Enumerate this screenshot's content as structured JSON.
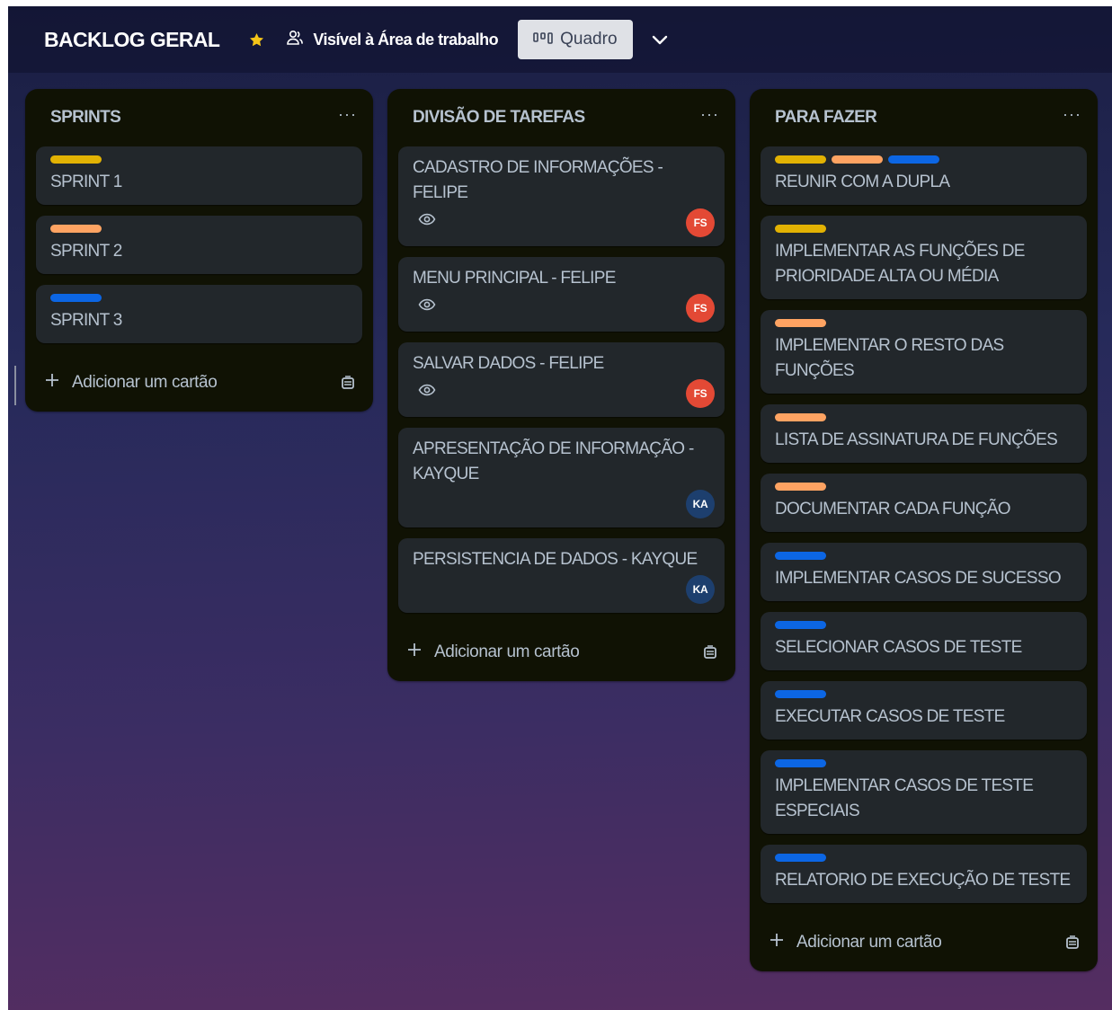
{
  "header": {
    "title": "BACKLOG GERAL",
    "visibility": "Visível à Área de trabalho",
    "view": "Quadro"
  },
  "colors": {
    "yellow": "#e2b203",
    "orange": "#fea362",
    "blue": "#0c66e4",
    "avatar_fs": "#e34935",
    "avatar_ka": "#1d3f6e"
  },
  "lists": [
    {
      "title": "SPRINTS",
      "menu": "···",
      "add_label": "Adicionar um cartão",
      "cards": [
        {
          "labels": [
            "yellow"
          ],
          "title": "SPRINT 1"
        },
        {
          "labels": [
            "orange"
          ],
          "title": "SPRINT 2"
        },
        {
          "labels": [
            "blue"
          ],
          "title": "SPRINT 3"
        }
      ]
    },
    {
      "title": "DIVISÃO DE TAREFAS",
      "menu": "···",
      "add_label": "Adicionar um cartão",
      "cards": [
        {
          "title": "CADASTRO DE INFORMAÇÕES - FELIPE",
          "watch": true,
          "avatar": "FS"
        },
        {
          "title": "MENU PRINCIPAL - FELIPE",
          "watch": true,
          "avatar": "FS"
        },
        {
          "title": "SALVAR DADOS - FELIPE",
          "watch": true,
          "avatar": "FS"
        },
        {
          "title": "APRESENTAÇÃO DE INFORMAÇÃO - KAYQUE",
          "watch": false,
          "avatar": "KA"
        },
        {
          "title": "PERSISTENCIA DE DADOS - KAYQUE",
          "watch": false,
          "avatar": "KA"
        }
      ]
    },
    {
      "title": "PARA FAZER",
      "menu": "···",
      "add_label": "Adicionar um cartão",
      "cards": [
        {
          "labels": [
            "yellow",
            "orange",
            "blue"
          ],
          "title": "REUNIR COM A DUPLA"
        },
        {
          "labels": [
            "yellow"
          ],
          "title": "IMPLEMENTAR AS FUNÇÕES DE PRIORIDADE ALTA OU MÉDIA"
        },
        {
          "labels": [
            "orange"
          ],
          "title": "IMPLEMENTAR O RESTO DAS FUNÇÕES"
        },
        {
          "labels": [
            "orange"
          ],
          "title": "LISTA DE ASSINATURA DE FUNÇÕES"
        },
        {
          "labels": [
            "orange"
          ],
          "title": "DOCUMENTAR CADA FUNÇÃO"
        },
        {
          "labels": [
            "blue"
          ],
          "title": "IMPLEMENTAR CASOS DE SUCESSO"
        },
        {
          "labels": [
            "blue"
          ],
          "title": "SELECIONAR CASOS DE TESTE"
        },
        {
          "labels": [
            "blue"
          ],
          "title": "EXECUTAR CASOS DE TESTE"
        },
        {
          "labels": [
            "blue"
          ],
          "title": "IMPLEMENTAR CASOS DE TESTE ESPECIAIS"
        },
        {
          "labels": [
            "blue"
          ],
          "title": "RELATORIO DE EXECUÇÃO DE TESTE"
        }
      ]
    }
  ]
}
